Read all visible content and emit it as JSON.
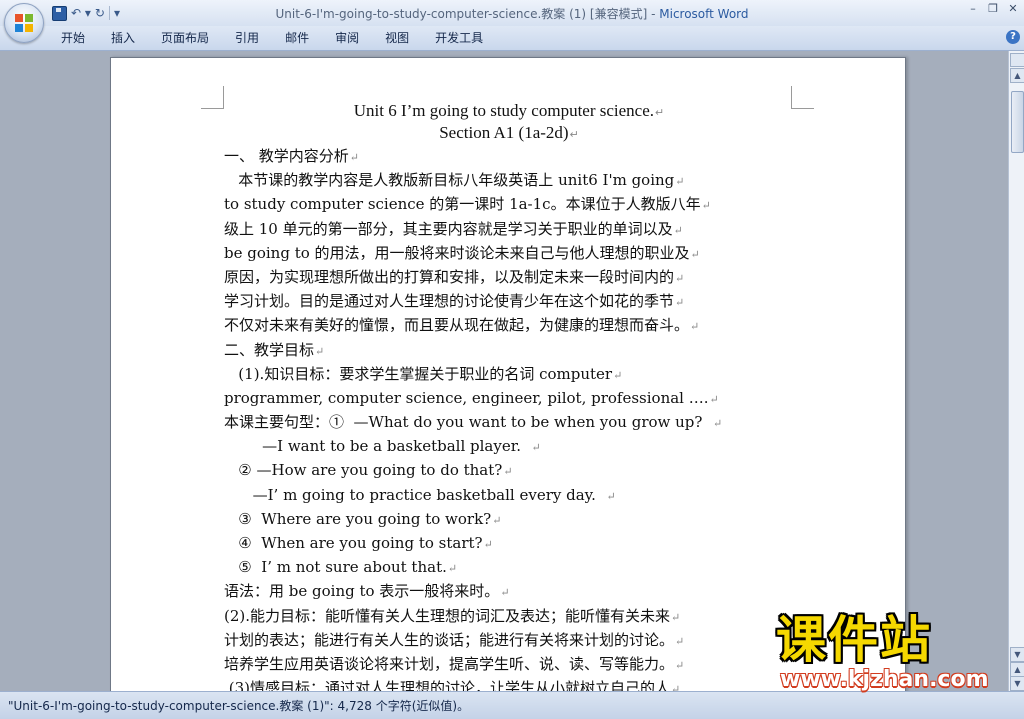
{
  "window": {
    "title_doc": "Unit-6-I'm-going-to-study-computer-science.教案 (1) [兼容模式] - ",
    "title_app": "Microsoft Word",
    "controls": {
      "minimize": "–",
      "restore": "❐",
      "close": "✕"
    }
  },
  "qat": {
    "undo": "↶ ▾",
    "redo": "↻",
    "customize": "▾"
  },
  "ribbon": {
    "tabs": [
      "开始",
      "插入",
      "页面布局",
      "引用",
      "邮件",
      "审阅",
      "视图",
      "开发工具"
    ],
    "help": "?"
  },
  "document": {
    "paragraph_mark": "↵",
    "lines": [
      "Unit 6 I’m going to study computer science.",
      "Section A1 (1a-2d)",
      "一、 教学内容分析",
      "   本节课的教学内容是人教版新目标八年级英语上 unit6 I'm going",
      "to study computer science 的第一课时 1a-1c。本课位于人教版八年",
      "级上 10 单元的第一部分，其主要内容就是学习关于职业的单词以及",
      "be going to 的用法，用一般将来时谈论未来自己与他人理想的职业及",
      "原因，为实现理想所做出的打算和安排，以及制定未来一段时间内的",
      "学习计划。目的是通过对人生理想的讨论使青少年在这个如花的季节",
      "不仅对未来有美好的憧憬，而且要从现在做起，为健康的理想而奋斗。",
      "二、教学目标",
      "   (1).知识目标：要求学生掌握关于职业的名词 computer",
      "programmer, computer science, engineer, pilot, professional ….",
      "本课主要句型：①  —What do you want to be when you grow up?  ",
      "        —I want to be a basketball player.  ",
      "   ② —How are you going to do that?",
      "      —I’ m going to practice basketball every day.  ",
      "   ③  Where are you going to work?",
      "   ④  When are you going to start?",
      "   ⑤  I’ m not sure about that.",
      "语法：用 be going to 表示一般将来时。",
      "(2).能力目标：能听懂有关人生理想的词汇及表达；能听懂有关未来",
      "计划的表达；能进行有关人生的谈话；能进行有关将来计划的讨论。",
      "培养学生应用英语谈论将来计划，提高学生听、说、读、写等能力。",
      " (3)情感目标：通过对人生理想的讨论，让学生从小就树立自己的人"
    ]
  },
  "statusbar": {
    "text": "\"Unit-6-I'm-going-to-study-computer-science.教案 (1)\": 4,728 个字符(近似值)。"
  },
  "watermark": {
    "big": "课件站",
    "small": "www.kjzhan.com"
  }
}
